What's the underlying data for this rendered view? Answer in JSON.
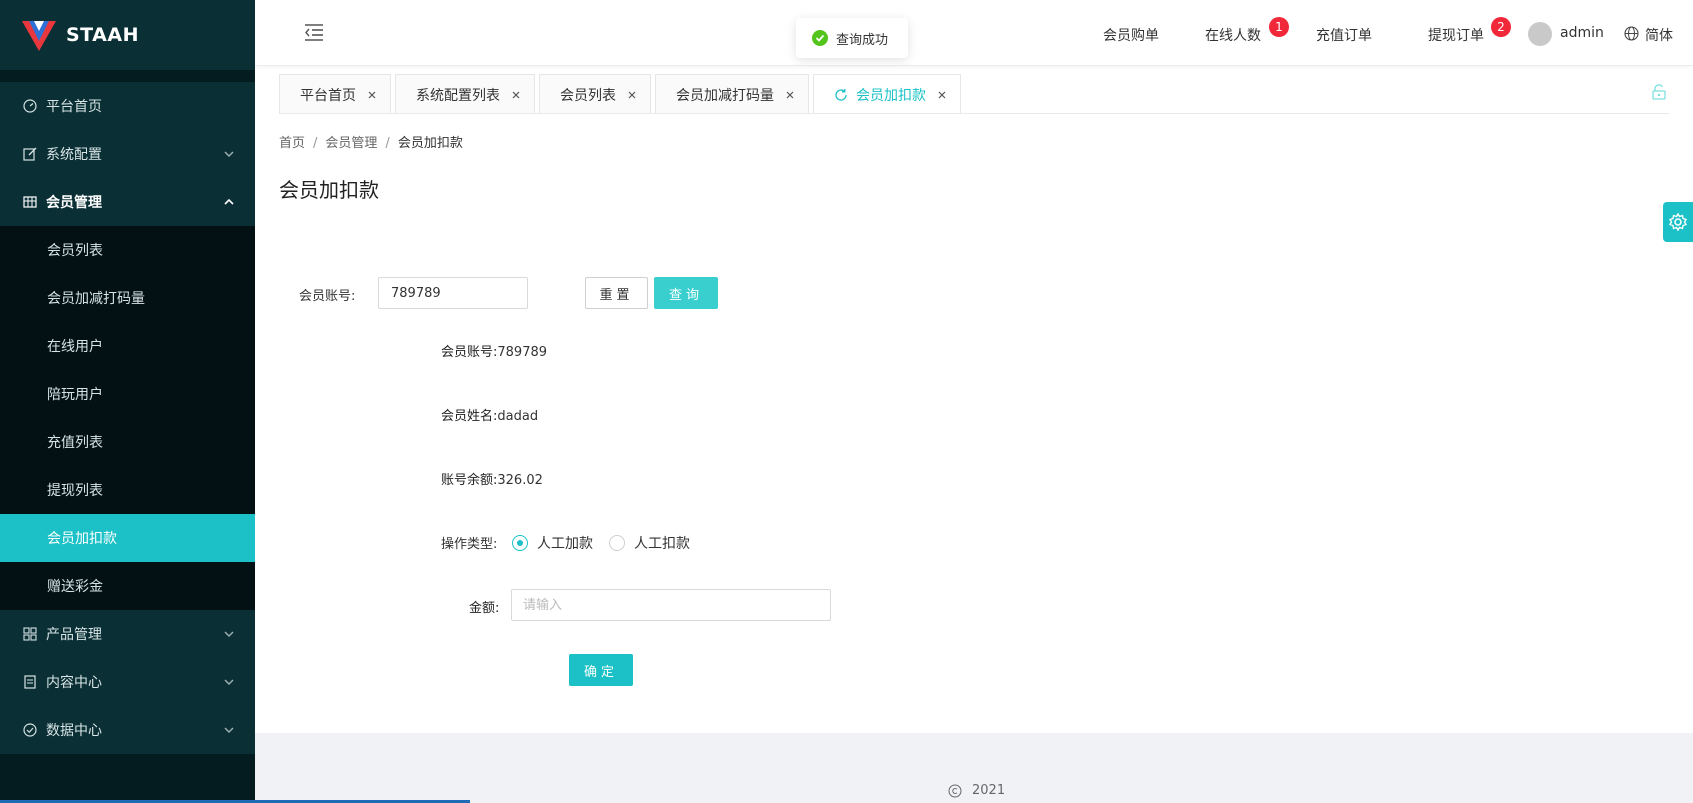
{
  "brand": {
    "name": "STAAH"
  },
  "sidebar": {
    "items": [
      {
        "label": "平台首页",
        "icon": "dashboard-icon"
      },
      {
        "label": "系统配置",
        "icon": "edit-icon"
      },
      {
        "label": "会员管理",
        "icon": "table-icon"
      },
      {
        "label": "产品管理",
        "icon": "grid-icon"
      },
      {
        "label": "内容中心",
        "icon": "document-icon"
      },
      {
        "label": "数据中心",
        "icon": "check-circle-icon"
      }
    ],
    "sub_items": [
      "会员列表",
      "会员加减打码量",
      "在线用户",
      "陪玩用户",
      "充值列表",
      "提现列表",
      "会员加扣款",
      "赠送彩金"
    ]
  },
  "header": {
    "toast": "查询成功",
    "links": {
      "member_orders": "会员购单",
      "online_count": "在线人数",
      "online_badge": "1",
      "recharge_orders": "充值订单",
      "withdraw_orders": "提现订单",
      "withdraw_badge": "2"
    },
    "user": "admin",
    "language": "简体"
  },
  "tabs": [
    {
      "label": "平台首页"
    },
    {
      "label": "系统配置列表"
    },
    {
      "label": "会员列表"
    },
    {
      "label": "会员加减打码量"
    },
    {
      "label": "会员加扣款"
    }
  ],
  "breadcrumb": {
    "home": "首页",
    "section": "会员管理",
    "current": "会员加扣款"
  },
  "page": {
    "title": "会员加扣款",
    "search_label": "会员账号:",
    "search_value": "789789",
    "reset_label": "重置",
    "query_label": "查询",
    "account_label": "会员账号:",
    "account_value": "789789",
    "name_label": "会员姓名:",
    "name_value": "dadad",
    "balance_label": "账号余额:",
    "balance_value": "326.02",
    "op_label": "操作类型:",
    "op_add": "人工加款",
    "op_deduct": "人工扣款",
    "amount_label": "金额:",
    "amount_placeholder": "请输入",
    "confirm_label": "确定"
  },
  "footer": {
    "text": "2021"
  },
  "colors": {
    "accent": "#1bc1c6",
    "sidebar": "#041b1f",
    "badge": "#f0283a"
  }
}
